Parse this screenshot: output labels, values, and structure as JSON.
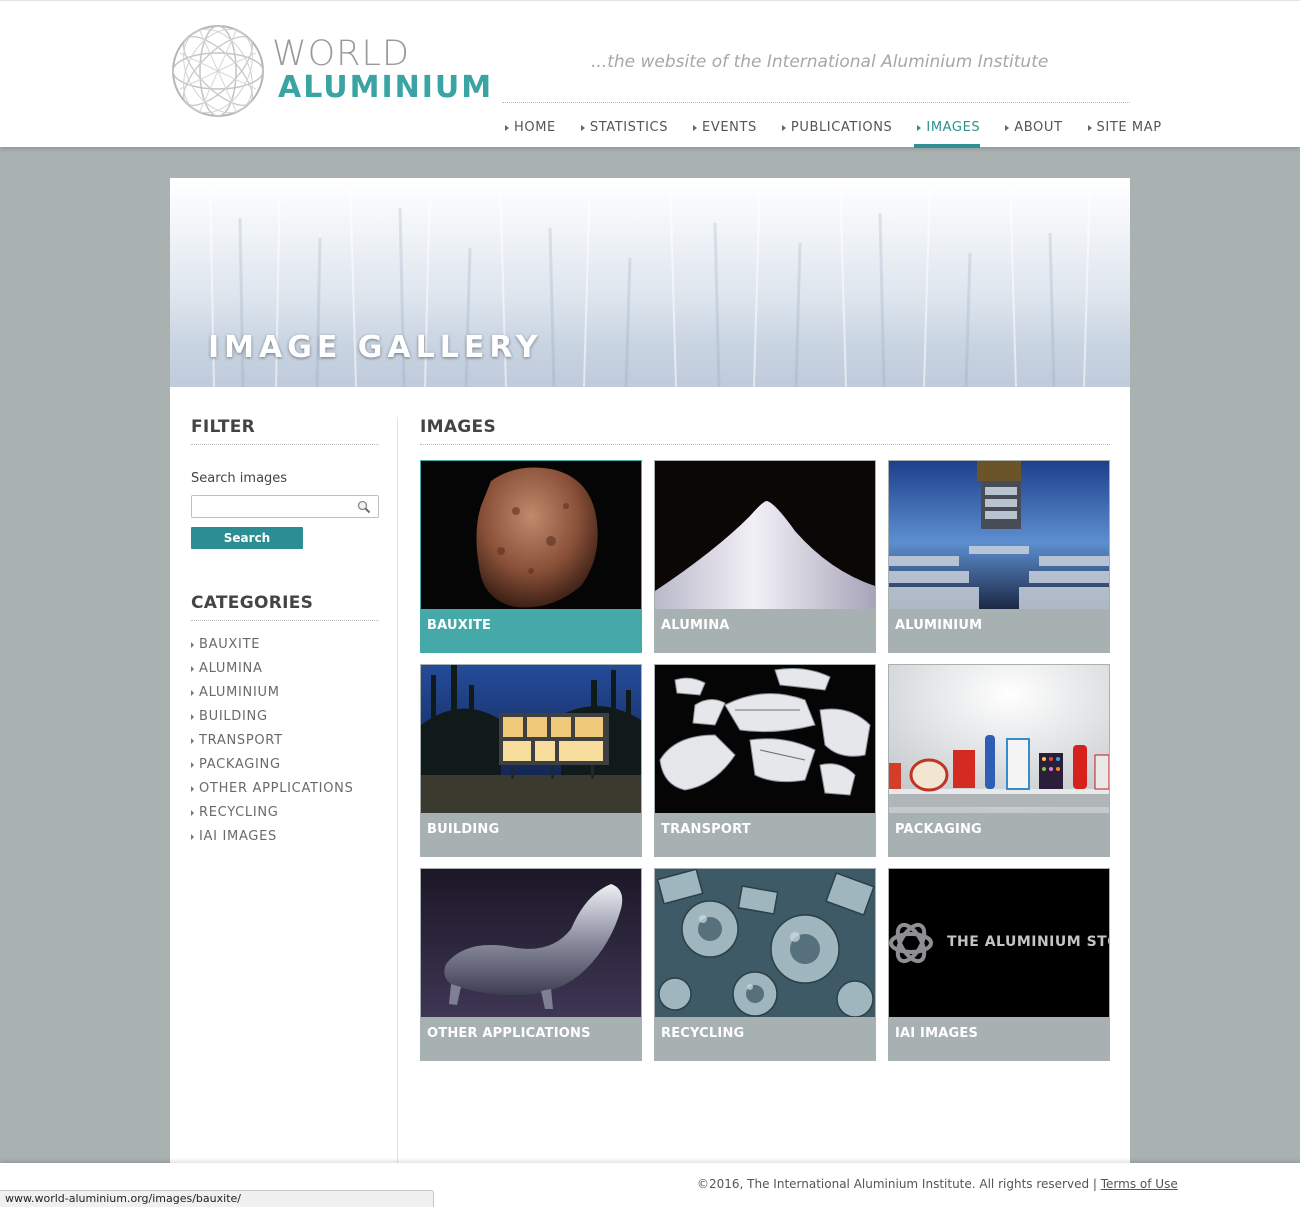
{
  "header": {
    "logo_world": "WORLD",
    "logo_aluminium": "ALUMINIUM",
    "tagline": "...the website of the International Aluminium Institute",
    "nav": [
      {
        "label": "HOME",
        "active": false
      },
      {
        "label": "STATISTICS",
        "active": false
      },
      {
        "label": "EVENTS",
        "active": false
      },
      {
        "label": "PUBLICATIONS",
        "active": false
      },
      {
        "label": "IMAGES",
        "active": true
      },
      {
        "label": "ABOUT",
        "active": false
      },
      {
        "label": "SITE MAP",
        "active": false
      }
    ]
  },
  "banner": {
    "title": "IMAGE GALLERY"
  },
  "sidebar": {
    "filter_heading": "FILTER",
    "search_label": "Search images",
    "search_value": "",
    "search_placeholder": "",
    "search_button": "Search",
    "categories_heading": "CATEGORIES",
    "categories": [
      "BAUXITE",
      "ALUMINA",
      "ALUMINIUM",
      "BUILDING",
      "TRANSPORT",
      "PACKAGING",
      "OTHER APPLICATIONS",
      "RECYCLING",
      "IAI IMAGES"
    ]
  },
  "images": {
    "heading": "IMAGES",
    "tiles": [
      {
        "label": "BAUXITE",
        "active": true
      },
      {
        "label": "ALUMINA",
        "active": false
      },
      {
        "label": "ALUMINIUM",
        "active": false
      },
      {
        "label": "BUILDING",
        "active": false
      },
      {
        "label": "TRANSPORT",
        "active": false
      },
      {
        "label": "PACKAGING",
        "active": false
      },
      {
        "label": "OTHER APPLICATIONS",
        "active": false
      },
      {
        "label": "RECYCLING",
        "active": false
      },
      {
        "label": "IAI IMAGES",
        "active": false
      }
    ],
    "iai_thumb_text": "THE ALUMINIUM STORY"
  },
  "footer": {
    "copyright": "©2016, The International Aluminium Institute. All rights reserved |",
    "terms": "Terms of Use"
  },
  "status_bar": {
    "url": "www.world-aluminium.org/images/bauxite/"
  },
  "colors": {
    "accent": "#2f8f92",
    "tile_active": "#45a9a9",
    "tile_default": "#a8b1b1",
    "page_bg": "#a9b1b1"
  }
}
